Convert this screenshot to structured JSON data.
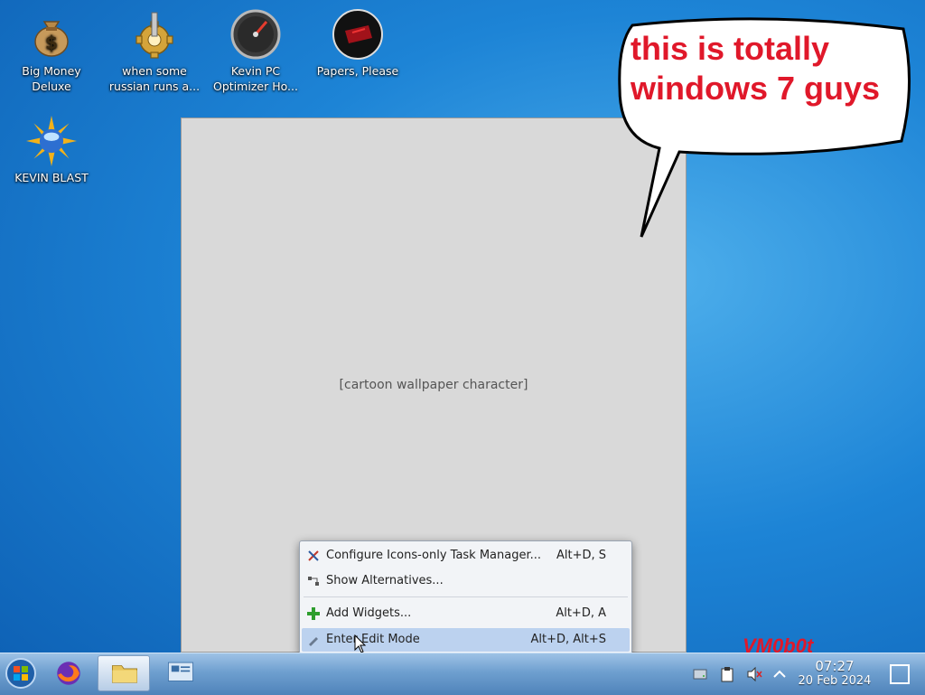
{
  "desktop": {
    "icons": [
      {
        "label": "Big Money Deluxe",
        "icon": "money-bag-icon"
      },
      {
        "label": "when some russian runs a...",
        "icon": "gear-icon"
      },
      {
        "label": "Kevin PC Optimizer Ho...",
        "icon": "speedometer-icon"
      },
      {
        "label": "Papers, Please",
        "icon": "papers-please-icon"
      },
      {
        "label": "KEVIN BLAST",
        "icon": "sun-globe-icon"
      }
    ],
    "speech_bubble": "this is totally windows 7 guys",
    "watermark": "VM0b0t"
  },
  "context_menu": {
    "items": [
      {
        "label": "Configure Icons-only Task Manager...",
        "shortcut": "Alt+D, S",
        "icon": "configure-icon"
      },
      {
        "label": "Show Alternatives...",
        "shortcut": "",
        "icon": "alternatives-icon"
      },
      {
        "label": "Add Widgets...",
        "shortcut": "Alt+D, A",
        "icon": "add-icon"
      },
      {
        "label": "Enter Edit Mode",
        "shortcut": "Alt+D, Alt+S",
        "icon": "edit-icon"
      }
    ],
    "selected": "Enter Edit Mode"
  },
  "taskbar": {
    "buttons": [
      {
        "name": "start-button",
        "icon": "windows-orb-icon"
      },
      {
        "name": "firefox",
        "icon": "firefox-icon"
      },
      {
        "name": "file-manager",
        "icon": "folder-icon"
      },
      {
        "name": "system-settings",
        "icon": "settings-icon"
      }
    ],
    "tray": [
      "disk-icon",
      "clipboard-icon",
      "volume-muted-icon",
      "chevron-up-icon"
    ],
    "clock": {
      "time": "07:27",
      "date": "20 Feb 2024"
    },
    "show_desktop": "show-desktop-icon"
  },
  "colors": {
    "accent_red": "#e0182a",
    "menu_highlight": "#bcd2ef",
    "desktop_blue": "#1d84d6"
  }
}
